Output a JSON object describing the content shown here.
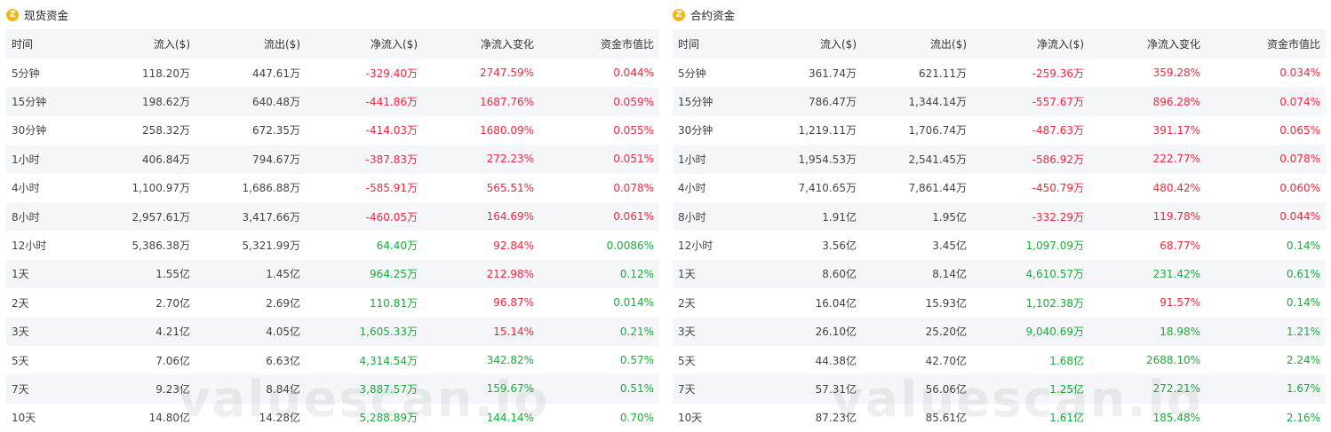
{
  "watermark": "valuescan.io",
  "colors": {
    "red": "#f0283c",
    "green": "#1bab3a",
    "coin": "#f0b90b",
    "row_alt": "#f4f6f9"
  },
  "headers": [
    "时间",
    "流入($)",
    "流出($)",
    "净流入($)",
    "净流入变化",
    "资金市值比"
  ],
  "spot": {
    "title": "现货资金",
    "rows": [
      [
        "5分钟",
        "118.20万",
        "447.61万",
        "-329.40万",
        "2747.59%",
        "0.044%"
      ],
      [
        "15分钟",
        "198.62万",
        "640.48万",
        "-441.86万",
        "1687.76%",
        "0.059%"
      ],
      [
        "30分钟",
        "258.32万",
        "672.35万",
        "-414.03万",
        "1680.09%",
        "0.055%"
      ],
      [
        "1小时",
        "406.84万",
        "794.67万",
        "-387.83万",
        "272.23%",
        "0.051%"
      ],
      [
        "4小时",
        "1,100.97万",
        "1,686.88万",
        "-585.91万",
        "565.51%",
        "0.078%"
      ],
      [
        "8小时",
        "2,957.61万",
        "3,417.66万",
        "-460.05万",
        "164.69%",
        "0.061%"
      ],
      [
        "12小时",
        "5,386.38万",
        "5,321.99万",
        "64.40万",
        "92.84%",
        "0.0086%"
      ],
      [
        "1天",
        "1.55亿",
        "1.45亿",
        "964.25万",
        "212.98%",
        "0.12%"
      ],
      [
        "2天",
        "2.70亿",
        "2.69亿",
        "110.81万",
        "96.87%",
        "0.014%"
      ],
      [
        "3天",
        "4.21亿",
        "4.05亿",
        "1,605.33万",
        "15.14%",
        "0.21%"
      ],
      [
        "5天",
        "7.06亿",
        "6.63亿",
        "4,314.54万",
        "342.82%",
        "0.57%"
      ],
      [
        "7天",
        "9.23亿",
        "8.84亿",
        "3,887.57万",
        "159.67%",
        "0.51%"
      ],
      [
        "10天",
        "14.80亿",
        "14.28亿",
        "5,288.89万",
        "144.14%",
        "0.70%"
      ]
    ],
    "colors": [
      [
        "red",
        "red",
        "red"
      ],
      [
        "red",
        "red",
        "red"
      ],
      [
        "red",
        "red",
        "red"
      ],
      [
        "red",
        "red",
        "red"
      ],
      [
        "red",
        "red",
        "red"
      ],
      [
        "red",
        "red",
        "red"
      ],
      [
        "green",
        "red",
        "green"
      ],
      [
        "green",
        "red",
        "green"
      ],
      [
        "green",
        "red",
        "green"
      ],
      [
        "green",
        "red",
        "green"
      ],
      [
        "green",
        "green",
        "green"
      ],
      [
        "green",
        "green",
        "green"
      ],
      [
        "green",
        "green",
        "green"
      ]
    ]
  },
  "futures": {
    "title": "合约资金",
    "rows": [
      [
        "5分钟",
        "361.74万",
        "621.11万",
        "-259.36万",
        "359.28%",
        "0.034%"
      ],
      [
        "15分钟",
        "786.47万",
        "1,344.14万",
        "-557.67万",
        "896.28%",
        "0.074%"
      ],
      [
        "30分钟",
        "1,219.11万",
        "1,706.74万",
        "-487.63万",
        "391.17%",
        "0.065%"
      ],
      [
        "1小时",
        "1,954.53万",
        "2,541.45万",
        "-586.92万",
        "222.77%",
        "0.078%"
      ],
      [
        "4小时",
        "7,410.65万",
        "7,861.44万",
        "-450.79万",
        "480.42%",
        "0.060%"
      ],
      [
        "8小时",
        "1.91亿",
        "1.95亿",
        "-332.29万",
        "119.78%",
        "0.044%"
      ],
      [
        "12小时",
        "3.56亿",
        "3.45亿",
        "1,097.09万",
        "68.77%",
        "0.14%"
      ],
      [
        "1天",
        "8.60亿",
        "8.14亿",
        "4,610.57万",
        "231.42%",
        "0.61%"
      ],
      [
        "2天",
        "16.04亿",
        "15.93亿",
        "1,102.38万",
        "91.57%",
        "0.14%"
      ],
      [
        "3天",
        "26.10亿",
        "25.20亿",
        "9,040.69万",
        "18.98%",
        "1.21%"
      ],
      [
        "5天",
        "44.38亿",
        "42.70亿",
        "1.68亿",
        "2688.10%",
        "2.24%"
      ],
      [
        "7天",
        "57.31亿",
        "56.06亿",
        "1.25亿",
        "272.21%",
        "1.67%"
      ],
      [
        "10天",
        "87.23亿",
        "85.61亿",
        "1.61亿",
        "185.48%",
        "2.16%"
      ]
    ],
    "colors": [
      [
        "red",
        "red",
        "red"
      ],
      [
        "red",
        "red",
        "red"
      ],
      [
        "red",
        "red",
        "red"
      ],
      [
        "red",
        "red",
        "red"
      ],
      [
        "red",
        "red",
        "red"
      ],
      [
        "red",
        "red",
        "red"
      ],
      [
        "green",
        "red",
        "green"
      ],
      [
        "green",
        "green",
        "green"
      ],
      [
        "green",
        "red",
        "green"
      ],
      [
        "green",
        "green",
        "green"
      ],
      [
        "green",
        "green",
        "green"
      ],
      [
        "green",
        "green",
        "green"
      ],
      [
        "green",
        "green",
        "green"
      ]
    ]
  }
}
